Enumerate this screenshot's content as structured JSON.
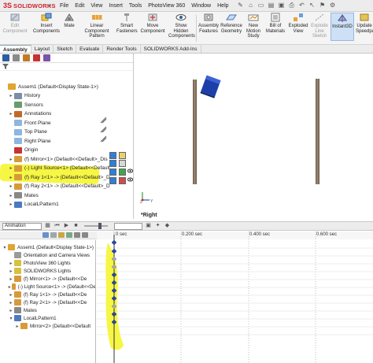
{
  "app": {
    "logo_mark": "3S",
    "logo_text": "SOLIDWORKS",
    "menus": [
      "File",
      "Edit",
      "View",
      "Insert",
      "Tools",
      "PhotoView 360",
      "Window",
      "Help"
    ]
  },
  "ribbon": {
    "buttons": [
      {
        "label": "Edit Component",
        "dim": true
      },
      {
        "label": "Insert Components"
      },
      {
        "label": "Mate"
      },
      {
        "label": "Linear Component Pattern"
      },
      {
        "label": "Smart Fasteners"
      },
      {
        "label": "Move Component"
      },
      {
        "label": "Show Hidden Components"
      },
      {
        "label": "Assembly Features"
      },
      {
        "label": "Reference Geometry"
      },
      {
        "label": "New Motion Study"
      },
      {
        "label": "Bill of Materials"
      },
      {
        "label": "Exploded View"
      },
      {
        "label": "Explode Line Sketch",
        "dim": true
      },
      {
        "label": "Instant3D",
        "active": true
      },
      {
        "label": "Update Speedpak"
      }
    ]
  },
  "command_tabs": [
    "Assembly",
    "Layout",
    "Sketch",
    "Evaluate",
    "Render Tools",
    "SOLIDWORKS Add-Ins"
  ],
  "feature_tree": {
    "items": [
      {
        "label": "Assem1  (Default<Display State-1>)",
        "icon": "assembly-icon",
        "indent": 0,
        "expander": ""
      },
      {
        "label": "History",
        "icon": "history-icon",
        "indent": 1,
        "expander": "▸"
      },
      {
        "label": "Sensors",
        "icon": "sensor-icon",
        "indent": 1,
        "expander": ""
      },
      {
        "label": "Annotations",
        "icon": "annotation-icon",
        "indent": 1,
        "expander": "▸"
      },
      {
        "label": "Front Plane",
        "icon": "plane-icon",
        "indent": 1,
        "expander": ""
      },
      {
        "label": "Top Plane",
        "icon": "plane-icon",
        "indent": 1,
        "expander": ""
      },
      {
        "label": "Right Plane",
        "icon": "plane-icon",
        "indent": 1,
        "expander": ""
      },
      {
        "label": "Origin",
        "icon": "origin-icon",
        "indent": 1,
        "expander": ""
      },
      {
        "label": "(f) Mirror<1> (Default<<Default>_Dis",
        "icon": "part-icon",
        "indent": 1,
        "expander": "▸"
      },
      {
        "label": "(-) Light Source<1> (Default<<Default",
        "icon": "part-icon",
        "indent": 1,
        "expander": "▸"
      },
      {
        "label": "(f) Ray 1<1> -> (Default<<Default>_D",
        "icon": "part-icon",
        "indent": 1,
        "expander": "▸"
      },
      {
        "label": "(f) Ray 2<1> -> (Default<<Default>_D",
        "icon": "part-icon",
        "indent": 1,
        "expander": "▸"
      },
      {
        "label": "Mates",
        "icon": "mates-icon",
        "indent": 1,
        "expander": "▸"
      },
      {
        "label": "LocalLPattern1",
        "icon": "pattern-icon",
        "indent": 1,
        "expander": "▸"
      }
    ]
  },
  "viewport": {
    "view_label": "*Right"
  },
  "animation": {
    "study_type": "Animation"
  },
  "timeline": {
    "ticks": [
      "0 sec",
      "0.200 sec",
      "0.400 sec",
      "0.600 sec"
    ]
  },
  "motion_tree": {
    "items": [
      {
        "label": "Assem1  (Default<Display State-1>)",
        "icon": "assembly-icon",
        "indent": 0,
        "expander": "▾"
      },
      {
        "label": "Orientation and Camera Views",
        "icon": "camera-icon",
        "indent": 1,
        "expander": ""
      },
      {
        "label": "PhotoView 360 Lights",
        "icon": "lights-icon",
        "indent": 1,
        "expander": "▸"
      },
      {
        "label": "SOLIDWORKS Lights",
        "icon": "lights-icon",
        "indent": 1,
        "expander": "▸"
      },
      {
        "label": "(f) Mirror<1> -> (Default<<De",
        "icon": "part-icon",
        "indent": 1,
        "expander": "▸"
      },
      {
        "label": "(-) Light Source<1> -> (Default<<De",
        "icon": "part-icon",
        "indent": 1,
        "expander": "▸"
      },
      {
        "label": "(f) Ray 1<1> -> (Default<<De",
        "icon": "part-icon",
        "indent": 1,
        "expander": "▸"
      },
      {
        "label": "(f) Ray 2<1> -> (Default<<De",
        "icon": "part-icon",
        "indent": 1,
        "expander": "▸"
      },
      {
        "label": "Mates",
        "icon": "mates-icon",
        "indent": 1,
        "expander": "▸"
      },
      {
        "label": "LocalLPattern1",
        "icon": "pattern-icon",
        "indent": 1,
        "expander": "▾"
      },
      {
        "label": "Mirror<2> (Default<<Default",
        "icon": "part-icon",
        "indent": 2,
        "expander": "▸"
      }
    ]
  },
  "colors": {
    "accent": "#2757a8",
    "highlight": "#f5f53a",
    "logo": "#d0202e"
  }
}
